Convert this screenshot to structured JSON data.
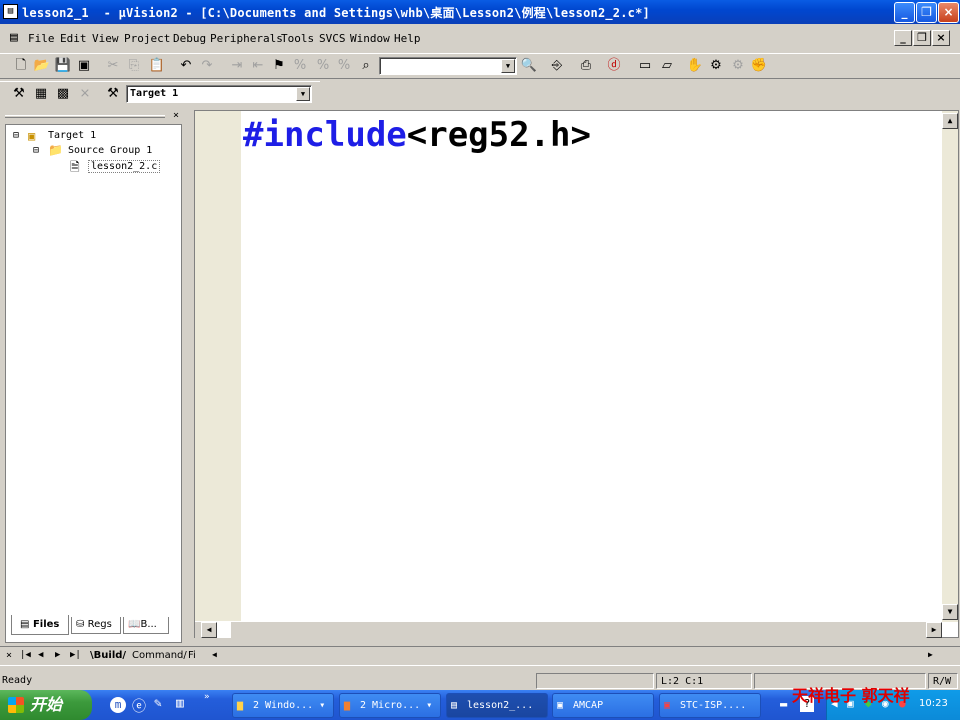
{
  "window": {
    "title": "lesson2_1  - µVision2 - [C:\\Documents and Settings\\whb\\桌面\\Lesson2\\例程\\lesson2_2.c*]",
    "controls": [
      "_",
      "❐",
      "×"
    ]
  },
  "menu": {
    "items": [
      "File",
      "Edit",
      "View",
      "Project",
      "Debug",
      "Peripherals",
      "Tools",
      "SVCS",
      "Window",
      "Help"
    ]
  },
  "toolbar": {
    "find_combo_value": "",
    "target_combo_value": "Target 1"
  },
  "project_tree": {
    "target": "Target 1",
    "group": "Source Group 1",
    "file": "lesson2_2.c"
  },
  "panel_tabs": [
    "Files",
    "Regs",
    "B..."
  ],
  "output_tabs": [
    "Build",
    "Command",
    "Fi"
  ],
  "editor": {
    "keyword": "#include",
    "rest": "<reg52.h>"
  },
  "status": {
    "left": "Ready",
    "position": "L:2 C:1",
    "mode": "R/W"
  },
  "taskbar": {
    "start_label": "开始",
    "tasks": [
      "2 Windo...",
      "2 Micro...",
      "lesson2_...",
      "AMCAP",
      "STC-ISP...."
    ],
    "clock": "10:23"
  },
  "watermark": "天祥电子  郭天祥"
}
